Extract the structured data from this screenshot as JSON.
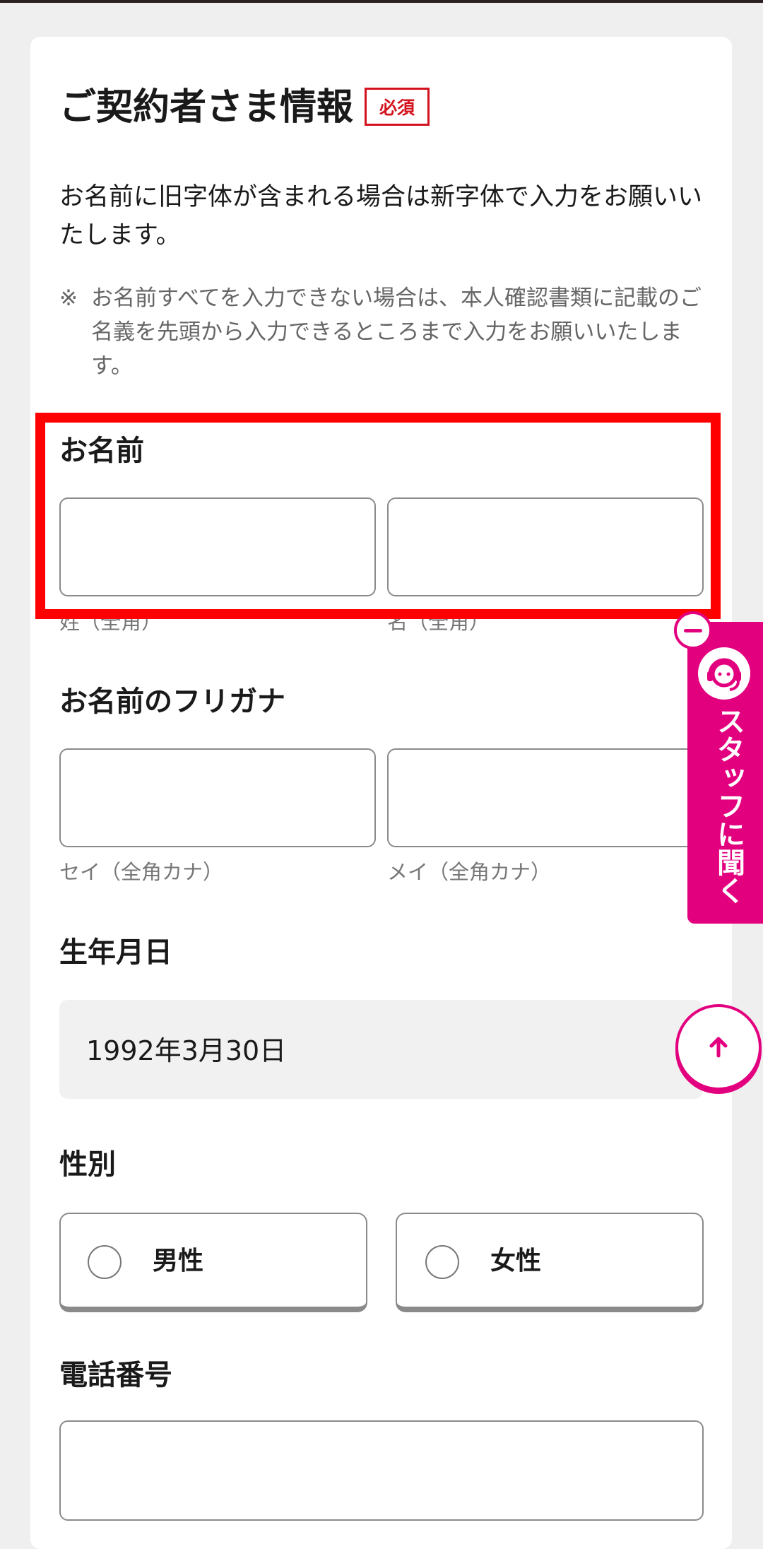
{
  "section": {
    "title": "ご契約者さま情報",
    "required_badge": "必須",
    "intro": "お名前に旧字体が含まれる場合は新字体で入力をお願いいたします。",
    "note_mark": "※",
    "note": "お名前すべてを入力できない場合は、本人確認書類に記載のご名義を先頭から入力できるところまで入力をお願いいたします。"
  },
  "name": {
    "label": "お名前",
    "last_caption": "姓（全角）",
    "first_caption": "名（全角）",
    "last_value": "",
    "first_value": ""
  },
  "kana": {
    "label": "お名前のフリガナ",
    "last_caption": "セイ（全角カナ）",
    "first_caption": "メイ（全角カナ）",
    "last_value": "",
    "first_value": ""
  },
  "birthdate": {
    "label": "生年月日",
    "value": "1992年3月30日"
  },
  "gender": {
    "label": "性別",
    "options": [
      "男性",
      "女性"
    ],
    "selected": null
  },
  "phone": {
    "label": "電話番号",
    "value": ""
  },
  "staff_widget": {
    "label": "スタッフに聞く",
    "icon": "headset-agent-icon",
    "collapse_icon": "minus-icon"
  },
  "scroll_top": {
    "icon": "arrow-up-icon"
  },
  "colors": {
    "accent_pink": "#e3007f",
    "required_red": "#d3121d",
    "highlight_red": "#ff0000"
  }
}
